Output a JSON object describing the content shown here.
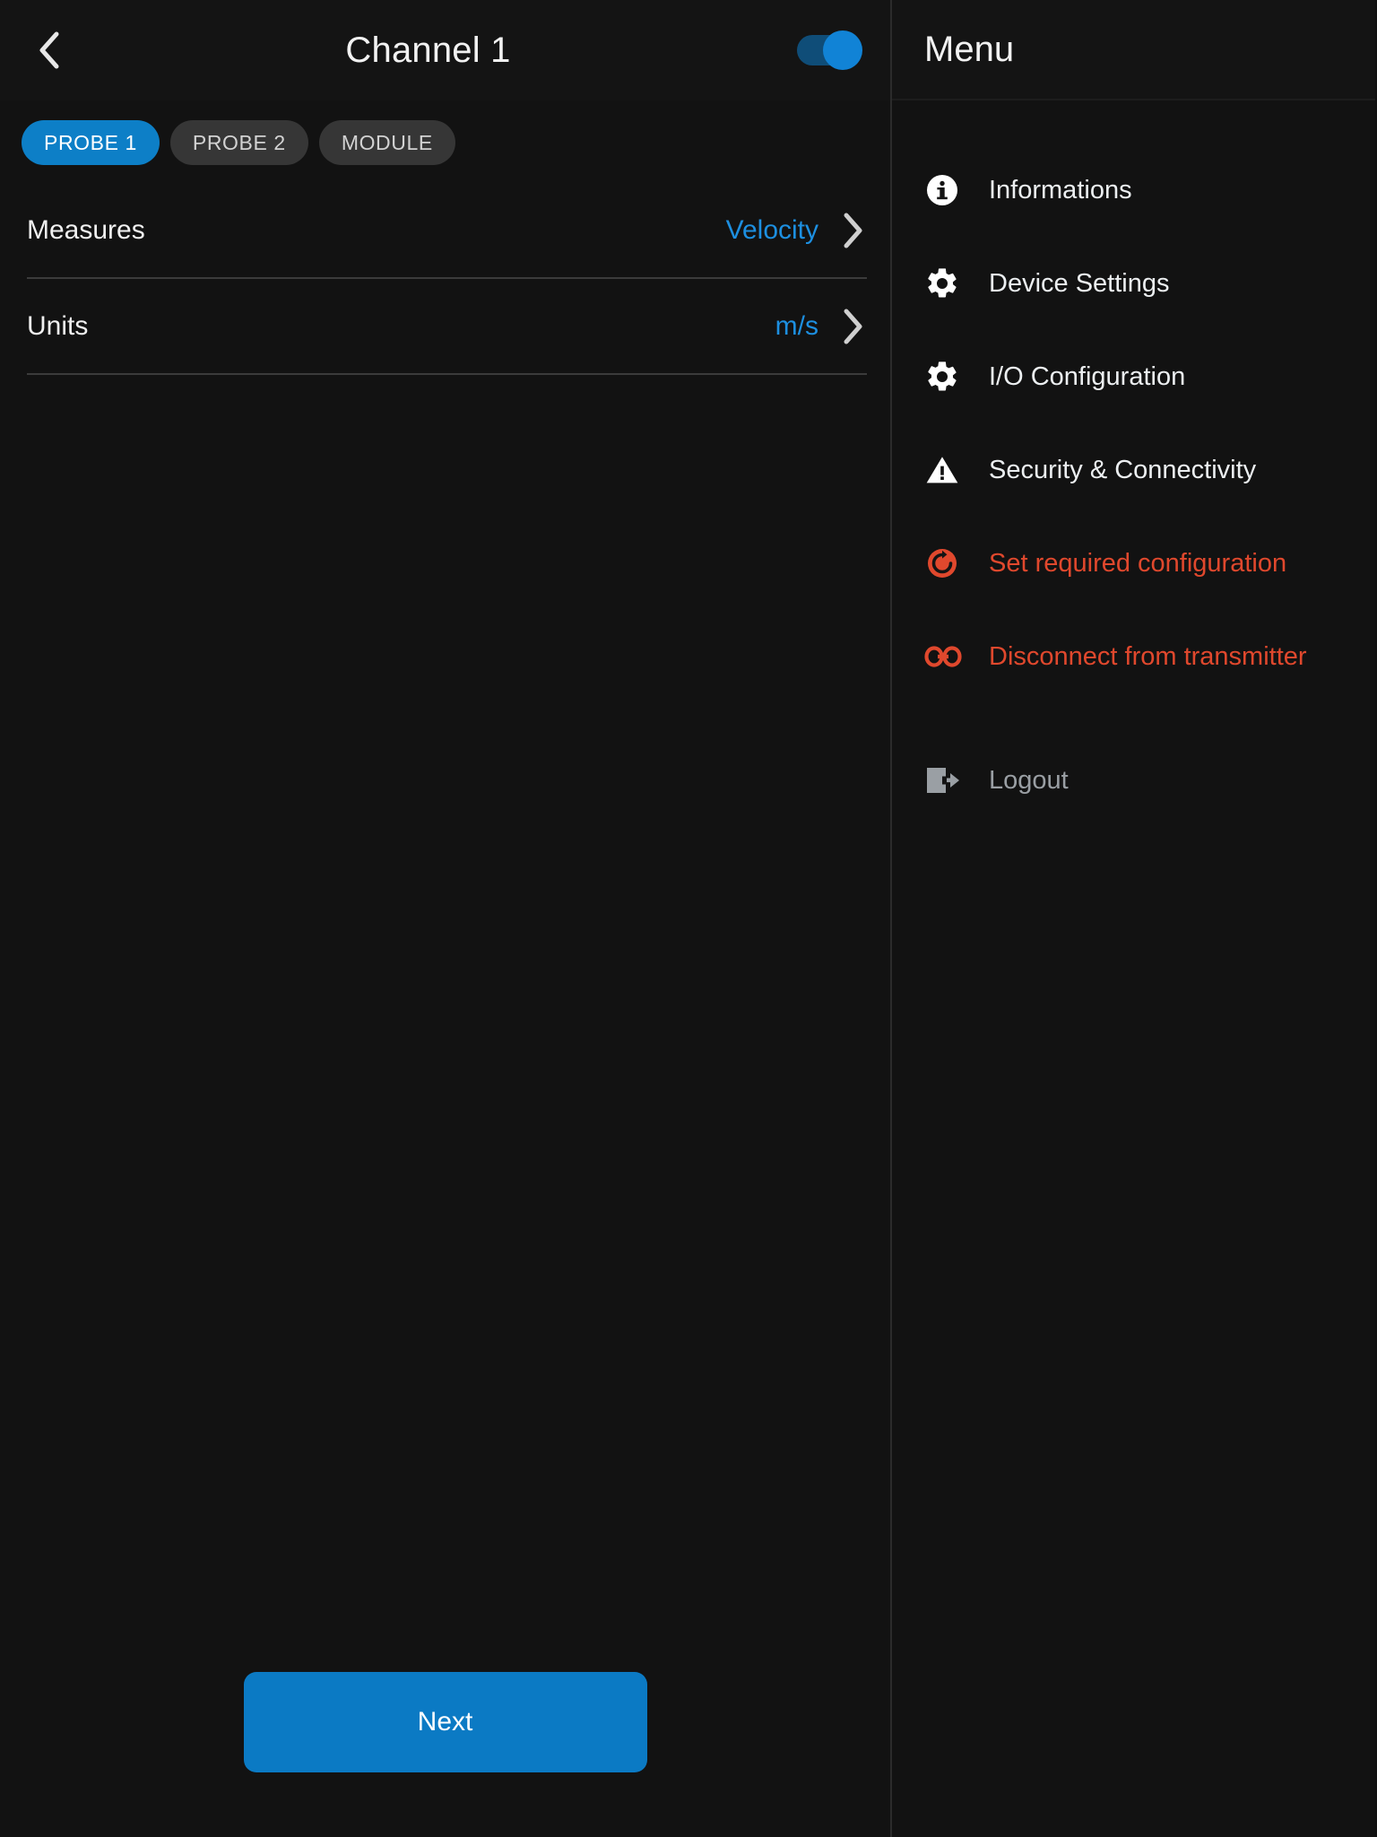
{
  "colors": {
    "accent_blue": "#0d7fc7",
    "value_blue": "#1d8fe0",
    "danger_red": "#e0482d",
    "muted_gray": "#9a9fa4",
    "panel_bg": "#121212",
    "tab_inactive": "#363636"
  },
  "header": {
    "back_icon": "chevron-left-icon",
    "title": "Channel 1",
    "toggle": {
      "name": "channel-enable-toggle",
      "state": "on"
    }
  },
  "tabs": [
    {
      "label": "PROBE 1",
      "active": true
    },
    {
      "label": "PROBE 2",
      "active": false
    },
    {
      "label": "MODULE",
      "active": false
    }
  ],
  "rows": [
    {
      "label": "Measures",
      "value": "Velocity",
      "chevron": "chevron-right-icon"
    },
    {
      "label": "Units",
      "value": "m/s",
      "chevron": "chevron-right-icon"
    }
  ],
  "footer": {
    "next_label": "Next"
  },
  "menu": {
    "title": "Menu",
    "items": [
      {
        "label": "Informations",
        "icon": "info-circle-icon",
        "style": "white",
        "gap": false
      },
      {
        "label": "Device Settings",
        "icon": "gear-icon",
        "style": "white",
        "gap": false
      },
      {
        "label": "I/O Configuration",
        "icon": "gear-icon",
        "style": "white",
        "gap": false
      },
      {
        "label": "Security & Connectivity",
        "icon": "warning-triangle-icon",
        "style": "white",
        "gap": false
      },
      {
        "label": "Set required configuration",
        "icon": "refresh-circle-icon",
        "style": "danger",
        "gap": false
      },
      {
        "label": "Disconnect from transmitter",
        "icon": "link-icon",
        "style": "danger",
        "gap": false
      },
      {
        "label": "Logout",
        "icon": "logout-icon",
        "style": "muted",
        "gap": true
      }
    ]
  }
}
